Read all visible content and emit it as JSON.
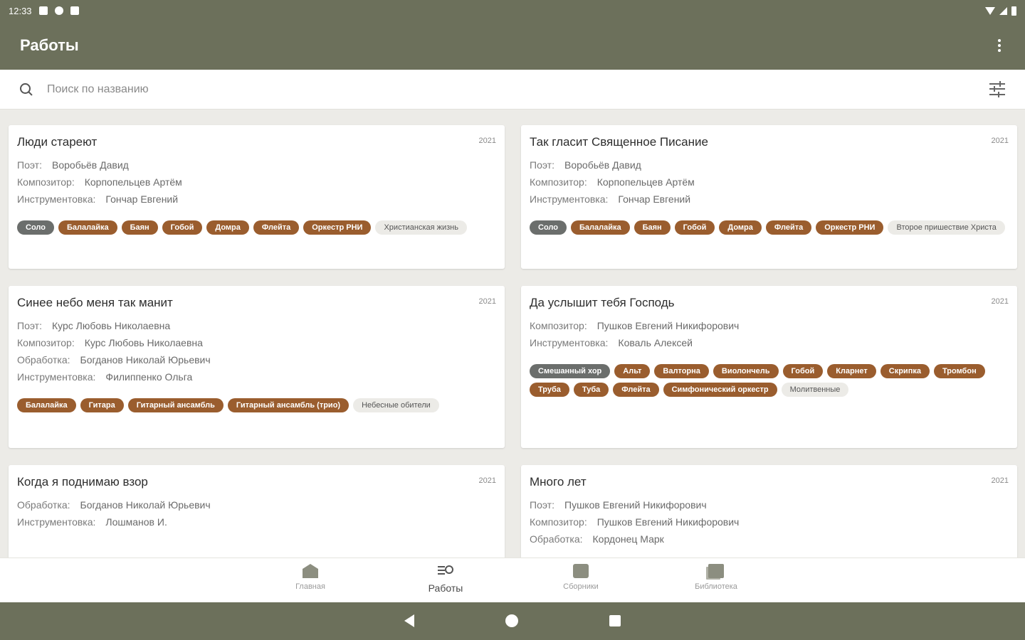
{
  "status": {
    "time": "12:33"
  },
  "app": {
    "title": "Работы"
  },
  "search": {
    "placeholder": "Поиск по названию"
  },
  "cards": [
    {
      "title": "Люди стареют",
      "year": "2021",
      "credits": [
        {
          "role": "Поэт:",
          "name": "Воробьёв Давид"
        },
        {
          "role": "Композитор:",
          "name": "Корпопельцев Артём"
        },
        {
          "role": "Инструментовка:",
          "name": "Гончар Евгений"
        }
      ],
      "tags": [
        {
          "label": "Соло",
          "style": "gray"
        },
        {
          "label": "Балалайка",
          "style": "brown"
        },
        {
          "label": "Баян",
          "style": "brown"
        },
        {
          "label": "Гобой",
          "style": "brown"
        },
        {
          "label": "Домра",
          "style": "brown"
        },
        {
          "label": "Флейта",
          "style": "brown"
        },
        {
          "label": "Оркестр РНИ",
          "style": "brown"
        },
        {
          "label": "Христианская жизнь",
          "style": "light"
        }
      ]
    },
    {
      "title": "Так гласит Священное Писание",
      "year": "2021",
      "credits": [
        {
          "role": "Поэт:",
          "name": "Воробьёв Давид"
        },
        {
          "role": "Композитор:",
          "name": "Корпопельцев Артём"
        },
        {
          "role": "Инструментовка:",
          "name": "Гончар Евгений"
        }
      ],
      "tags": [
        {
          "label": "Соло",
          "style": "gray"
        },
        {
          "label": "Балалайка",
          "style": "brown"
        },
        {
          "label": "Баян",
          "style": "brown"
        },
        {
          "label": "Гобой",
          "style": "brown"
        },
        {
          "label": "Домра",
          "style": "brown"
        },
        {
          "label": "Флейта",
          "style": "brown"
        },
        {
          "label": "Оркестр РНИ",
          "style": "brown"
        },
        {
          "label": "Второе пришествие Христа",
          "style": "light"
        }
      ]
    },
    {
      "title": "Синее небо меня так манит",
      "year": "2021",
      "credits": [
        {
          "role": "Поэт:",
          "name": "Курс Любовь Николаевна"
        },
        {
          "role": "Композитор:",
          "name": "Курс Любовь Николаевна"
        },
        {
          "role": "Обработка:",
          "name": "Богданов Николай Юрьевич"
        },
        {
          "role": "Инструментовка:",
          "name": "Филиппенко Ольга"
        }
      ],
      "tags": [
        {
          "label": "Балалайка",
          "style": "brown"
        },
        {
          "label": "Гитара",
          "style": "brown"
        },
        {
          "label": "Гитарный ансамбль",
          "style": "brown"
        },
        {
          "label": "Гитарный ансамбль (трио)",
          "style": "brown"
        },
        {
          "label": "Небесные обители",
          "style": "light"
        }
      ]
    },
    {
      "title": "Да услышит тебя Господь",
      "year": "2021",
      "credits": [
        {
          "role": "Композитор:",
          "name": "Пушков Евгений Никифорович"
        },
        {
          "role": "Инструментовка:",
          "name": "Коваль Алексей"
        }
      ],
      "tags": [
        {
          "label": "Смешанный хор",
          "style": "gray"
        },
        {
          "label": "Альт",
          "style": "brown"
        },
        {
          "label": "Валторна",
          "style": "brown"
        },
        {
          "label": "Виолончель",
          "style": "brown"
        },
        {
          "label": "Гобой",
          "style": "brown"
        },
        {
          "label": "Кларнет",
          "style": "brown"
        },
        {
          "label": "Скрипка",
          "style": "brown"
        },
        {
          "label": "Тромбон",
          "style": "brown"
        },
        {
          "label": "Труба",
          "style": "brown"
        },
        {
          "label": "Туба",
          "style": "brown"
        },
        {
          "label": "Флейта",
          "style": "brown"
        },
        {
          "label": "Симфонический оркестр",
          "style": "brown"
        },
        {
          "label": "Молитвенные",
          "style": "light"
        }
      ]
    },
    {
      "title": "Когда я поднимаю взор",
      "year": "2021",
      "credits": [
        {
          "role": "Обработка:",
          "name": "Богданов Николай Юрьевич"
        },
        {
          "role": "Инструментовка:",
          "name": "Лошманов И."
        }
      ],
      "tags": []
    },
    {
      "title": "Много лет",
      "year": "2021",
      "credits": [
        {
          "role": "Поэт:",
          "name": "Пушков Евгений Никифорович"
        },
        {
          "role": "Композитор:",
          "name": "Пушков Евгений Никифорович"
        },
        {
          "role": "Обработка:",
          "name": "Кордонец Марк"
        }
      ],
      "tags": []
    }
  ],
  "bottom_nav": [
    {
      "label": "Главная",
      "icon": "home-book-icon",
      "active": false
    },
    {
      "label": "Работы",
      "icon": "works-search-icon",
      "active": true
    },
    {
      "label": "Сборники",
      "icon": "collections-icon",
      "active": false
    },
    {
      "label": "Библиотека",
      "icon": "library-icon",
      "active": false
    }
  ],
  "colors": {
    "primary": "#6c705b",
    "tag_brown": "#9a5d2e",
    "tag_gray": "#6b6e6c",
    "background": "#ecebe7"
  }
}
